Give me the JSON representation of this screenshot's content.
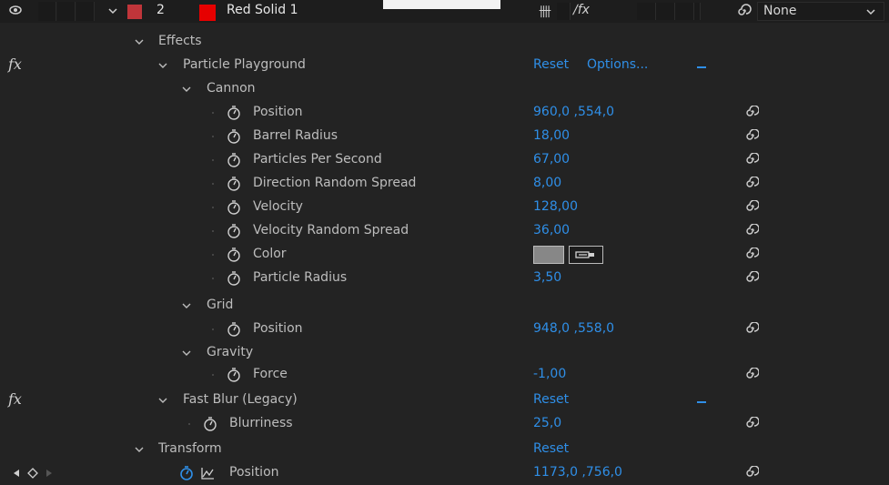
{
  "layer": {
    "number": "2",
    "name": "Red Solid 1",
    "label_color": "#c0353a",
    "solid_color": "#e60000"
  },
  "switches": {
    "shy_text": "卌",
    "fx_text": "∕fx"
  },
  "parent": {
    "value": "None"
  },
  "colors": {
    "value_blue": "#2f8fe8",
    "panel_bg": "#232323"
  },
  "properties": {
    "effects": {
      "label": "Effects"
    },
    "particle_playground": {
      "label": "Particle Playground",
      "fx": "fx",
      "reset": "Reset",
      "options": "Options..."
    },
    "cannon": {
      "label": "Cannon"
    },
    "cannon_position": {
      "label": "Position",
      "value": "960,0 ,554,0"
    },
    "barrel_radius": {
      "label": "Barrel Radius",
      "value": "18,00"
    },
    "particles_per_second": {
      "label": "Particles Per Second",
      "value": "67,00"
    },
    "direction_random_spread": {
      "label": "Direction Random Spread",
      "value": "8,00"
    },
    "velocity": {
      "label": "Velocity",
      "value": "128,00"
    },
    "velocity_random_spread": {
      "label": "Velocity Random Spread",
      "value": "36,00"
    },
    "color": {
      "label": "Color",
      "value": "#878787"
    },
    "particle_radius": {
      "label": "Particle Radius",
      "value": "3,50"
    },
    "grid": {
      "label": "Grid"
    },
    "grid_position": {
      "label": "Position",
      "value": "948,0 ,558,0"
    },
    "gravity": {
      "label": "Gravity"
    },
    "force": {
      "label": "Force",
      "value": "-1,00"
    },
    "fast_blur": {
      "label": "Fast Blur (Legacy)",
      "fx": "fx",
      "reset": "Reset"
    },
    "blurriness": {
      "label": "Blurriness",
      "value": "25,0"
    },
    "transform": {
      "label": "Transform",
      "reset": "Reset"
    },
    "transform_position": {
      "label": "Position",
      "value": "1173,0 ,756,0"
    }
  }
}
